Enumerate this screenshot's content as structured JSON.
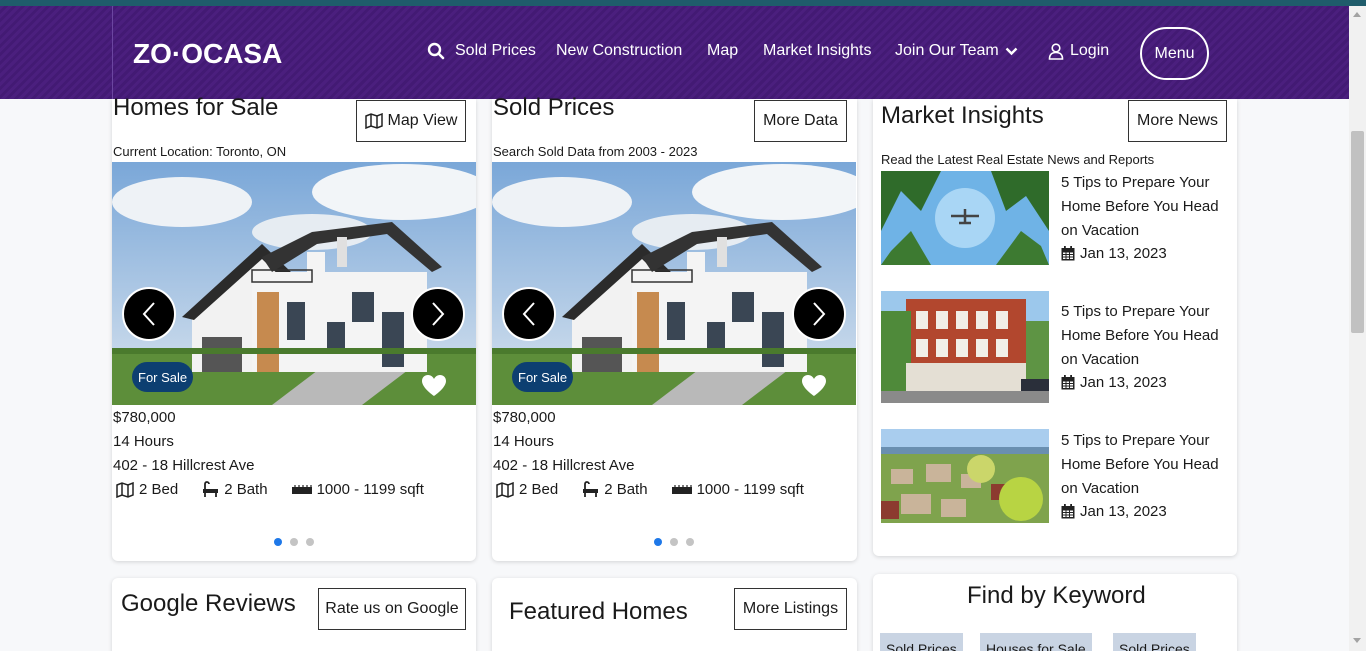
{
  "brand": {
    "logo_text": "ZO·OCASA"
  },
  "nav": {
    "items": [
      {
        "label": "Sold Prices",
        "icon": "search-icon"
      },
      {
        "label": "New Construction"
      },
      {
        "label": "Map"
      },
      {
        "label": "Market Insights"
      },
      {
        "label": "Join Our Team",
        "icon": "chevron-down-icon"
      },
      {
        "label": "Login",
        "icon": "user-icon"
      }
    ],
    "menu_label": "Menu"
  },
  "homes_for_sale": {
    "title": "Homes for Sale",
    "button": "Map View",
    "subtitle": "Current Location: Toronto, ON",
    "listing": {
      "badge": "For Sale",
      "price": "$780,000",
      "time": "14 Hours",
      "address": "402 - 18 Hillcrest Ave",
      "beds": "2 Bed",
      "baths": "2 Bath",
      "sqft": "1000 - 1199 sqft"
    }
  },
  "sold_prices": {
    "title": "Sold Prices",
    "button": "More Data",
    "subtitle": "Search Sold Data from 2003 - 2023",
    "listing": {
      "badge": "For Sale",
      "price": "$780,000",
      "time": "14 Hours",
      "address": "402 - 18 Hillcrest Ave",
      "beds": "2 Bed",
      "baths": "2 Bath",
      "sqft": "1000 - 1199 sqft"
    }
  },
  "market_insights": {
    "title": "Market Insights",
    "button": "More News",
    "subtitle": "Read the Latest Real Estate News and Reports",
    "articles": [
      {
        "title": "5 Tips to Prepare Your Home Before You Head on Vacation",
        "date": "Jan 13, 2023"
      },
      {
        "title": "5 Tips to Prepare Your Home Before You Head on Vacation",
        "date": "Jan 13, 2023"
      },
      {
        "title": "5 Tips to Prepare Your Home Before You Head on Vacation",
        "date": "Jan 13, 2023"
      }
    ]
  },
  "google_reviews": {
    "title": "Google Reviews",
    "button": "Rate us on Google"
  },
  "featured_homes": {
    "title": "Featured Homes",
    "button": "More Listings"
  },
  "find_by_keyword": {
    "title": "Find by Keyword",
    "chips": [
      "Sold Prices",
      "Houses for Sale",
      "Sold Prices"
    ]
  },
  "colors": {
    "nav_purple": "#4b1f7e",
    "badge_navy": "#0d3f71",
    "dot_active": "#1e78e8"
  }
}
